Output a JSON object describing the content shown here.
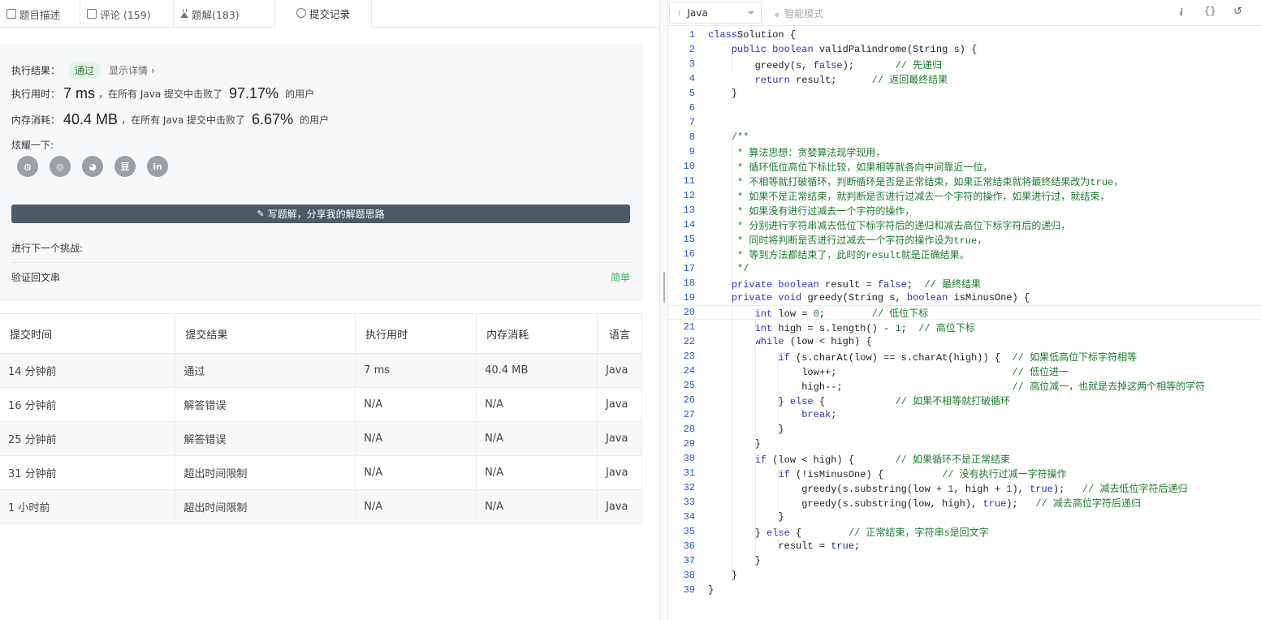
{
  "tabs": [
    {
      "label": "题目描述",
      "icon": "document-icon"
    },
    {
      "label": "评论 (159)",
      "icon": "comment-icon"
    },
    {
      "label": "题解(183)",
      "icon": "flask-icon"
    },
    {
      "label": "提交记录",
      "icon": "clock-icon"
    }
  ],
  "result": {
    "exec_label": "执行结果：",
    "status": "通过",
    "detail_link": "显示详情 ›",
    "time_label": "执行用时：",
    "time_value": "7 ms",
    "time_text": "，在所有 Java 提交中击败了",
    "time_percent": "97.17%",
    "time_suffix": "的用户",
    "mem_label": "内存消耗：",
    "mem_value": "40.4 MB",
    "mem_text": "，在所有 Java 提交中击败了",
    "mem_percent": "6.67%",
    "mem_suffix": "的用户",
    "share_label": "炫耀一下:",
    "share_icons": [
      "wechat-icon",
      "weibo-icon",
      "qq-icon",
      "douban-icon",
      "linkedin-icon"
    ],
    "share_glyphs": [
      "◍",
      "◎",
      "◕",
      "豆",
      "in"
    ],
    "write_button": "写题解，分享我的解题思路",
    "next_label": "进行下一个挑战:",
    "next_problem": "验证回文串",
    "next_difficulty": "简单"
  },
  "submissions": {
    "headers": [
      "提交时间",
      "提交结果",
      "执行用时",
      "内存消耗",
      "语言"
    ],
    "rows": [
      {
        "time": "14 分钟前",
        "result": "通过",
        "status": "pass",
        "runtime": "7 ms",
        "memory": "40.4 MB",
        "lang": "Java"
      },
      {
        "time": "16 分钟前",
        "result": "解答错误",
        "status": "fail",
        "runtime": "N/A",
        "memory": "N/A",
        "lang": "Java"
      },
      {
        "time": "25 分钟前",
        "result": "解答错误",
        "status": "fail",
        "runtime": "N/A",
        "memory": "N/A",
        "lang": "Java"
      },
      {
        "time": "31 分钟前",
        "result": "超出时间限制",
        "status": "fail",
        "runtime": "N/A",
        "memory": "N/A",
        "lang": "Java"
      },
      {
        "time": "1 小时前",
        "result": "超出时间限制",
        "status": "fail",
        "runtime": "N/A",
        "memory": "N/A",
        "lang": "Java"
      }
    ]
  },
  "editor_toolbar": {
    "language": "Java",
    "smart_mode": "智能模式",
    "info_icon": "i",
    "format_icon": "{}",
    "reset_icon": "↺"
  },
  "code": [
    [
      [
        "kw",
        "class"
      ],
      [
        "",
        "Solution {"
      ]
    ],
    [
      [
        "",
        "    "
      ],
      [
        "kw",
        "public"
      ],
      [
        "",
        ""
      ],
      [
        "kw",
        " boolean"
      ],
      [
        "",
        " validPalindrome(String s) {"
      ]
    ],
    [
      [
        "",
        "        greedy(s, "
      ],
      [
        "lit",
        "false"
      ],
      [
        "",
        ");       "
      ],
      [
        "cm",
        "// 先递归"
      ]
    ],
    [
      [
        "",
        "        "
      ],
      [
        "kw",
        "return"
      ],
      [
        "",
        " result;      "
      ],
      [
        "cm",
        "// 返回最终结果"
      ]
    ],
    [
      [
        "",
        "    }"
      ]
    ],
    [
      [
        "",
        ""
      ]
    ],
    [
      [
        "",
        ""
      ]
    ],
    [
      [
        "",
        "    "
      ],
      [
        "cm",
        "/**"
      ]
    ],
    [
      [
        "cm",
        "     * 算法思想：贪婪算法现学现用，"
      ]
    ],
    [
      [
        "cm",
        "     * 循环低位高位下标比较，如果相等就各向中间靠近一位，"
      ]
    ],
    [
      [
        "cm",
        "     * 不相等就打破循环，判断循环是否是正常结束，如果正常结束就将最终结果改为true，"
      ]
    ],
    [
      [
        "cm",
        "     * 如果不是正常结束，就判断是否进行过减去一个字符的操作，如果进行过，就结束，"
      ]
    ],
    [
      [
        "cm",
        "     * 如果没有进行过减去一个字符的操作，"
      ]
    ],
    [
      [
        "cm",
        "     * 分别进行字符串减去低位下标字符后的递归和减去高位下标字符后的递归，"
      ]
    ],
    [
      [
        "cm",
        "     * 同时将判断是否进行过减去一个字符的操作设为true，"
      ]
    ],
    [
      [
        "cm",
        "     * 等到方法都结束了，此时的result就是正确结果。"
      ]
    ],
    [
      [
        "cm",
        "     */"
      ]
    ],
    [
      [
        "",
        "    "
      ],
      [
        "kw",
        "private"
      ],
      [
        "kw",
        " boolean"
      ],
      [
        "",
        " result = "
      ],
      [
        "lit",
        "false"
      ],
      [
        "",
        ";  "
      ],
      [
        "cm",
        "// 最终结果"
      ]
    ],
    [
      [
        "",
        "    "
      ],
      [
        "kw",
        "private"
      ],
      [
        "kw",
        " void"
      ],
      [
        "",
        " greedy(String s, "
      ],
      [
        "kw",
        "boolean"
      ],
      [
        "",
        " isMinusOne) {"
      ]
    ],
    [
      [
        "",
        "        "
      ],
      [
        "kw",
        "int"
      ],
      [
        "",
        " low = "
      ],
      [
        "num",
        "0"
      ],
      [
        "",
        ";        "
      ],
      [
        "cm",
        "// 低位下标"
      ]
    ],
    [
      [
        "",
        "        "
      ],
      [
        "kw",
        "int"
      ],
      [
        "",
        " high = s.length() - "
      ],
      [
        "num",
        "1"
      ],
      [
        "",
        ";  "
      ],
      [
        "cm",
        "// 高位下标"
      ]
    ],
    [
      [
        "",
        "        "
      ],
      [
        "kw",
        "while"
      ],
      [
        "",
        " (low < high) {"
      ]
    ],
    [
      [
        "",
        "            "
      ],
      [
        "kw",
        "if"
      ],
      [
        "",
        " (s.charAt(low) == s.charAt(high)) {  "
      ],
      [
        "cm",
        "// 如果低高位下标字符相等"
      ]
    ],
    [
      [
        "",
        "                low++;                              "
      ],
      [
        "cm",
        "// 低位进一"
      ]
    ],
    [
      [
        "",
        "                high--;                             "
      ],
      [
        "cm",
        "// 高位减一，也就是去掉这两个相等的字符"
      ]
    ],
    [
      [
        "",
        "            } "
      ],
      [
        "kw",
        "else"
      ],
      [
        "",
        " {            "
      ],
      [
        "cm",
        "// 如果不相等就打破循环"
      ]
    ],
    [
      [
        "",
        "                "
      ],
      [
        "kw",
        "break"
      ],
      [
        "",
        ";"
      ]
    ],
    [
      [
        "",
        "            }"
      ]
    ],
    [
      [
        "",
        "        }"
      ]
    ],
    [
      [
        "",
        "        "
      ],
      [
        "kw",
        "if"
      ],
      [
        "",
        " (low < high) {       "
      ],
      [
        "cm",
        "// 如果循环不是正常结束"
      ]
    ],
    [
      [
        "",
        "            "
      ],
      [
        "kw",
        "if"
      ],
      [
        "",
        " (!isMinusOne) {          "
      ],
      [
        "cm",
        "// 没有执行过减一字符操作"
      ]
    ],
    [
      [
        "",
        "                greedy(s.substring(low + "
      ],
      [
        "num",
        "1"
      ],
      [
        "",
        ", high + "
      ],
      [
        "num",
        "1"
      ],
      [
        "",
        "), "
      ],
      [
        "lit",
        "true"
      ],
      [
        "",
        ");   "
      ],
      [
        "cm",
        "// 减去低位字符后递归"
      ]
    ],
    [
      [
        "",
        "                greedy(s.substring(low, high), "
      ],
      [
        "lit",
        "true"
      ],
      [
        "",
        ");   "
      ],
      [
        "cm",
        "// 减去高位字符后递归"
      ]
    ],
    [
      [
        "",
        "            }"
      ]
    ],
    [
      [
        "",
        "        } "
      ],
      [
        "kw",
        "else"
      ],
      [
        "",
        " {        "
      ],
      [
        "cm",
        "// 正常结束，字符串s是回文字"
      ]
    ],
    [
      [
        "",
        "            result = "
      ],
      [
        "lit",
        "true"
      ],
      [
        "",
        ";"
      ]
    ],
    [
      [
        "",
        "        }"
      ]
    ],
    [
      [
        "",
        "    }"
      ]
    ],
    [
      [
        "",
        "}"
      ]
    ]
  ],
  "active_line": 20
}
